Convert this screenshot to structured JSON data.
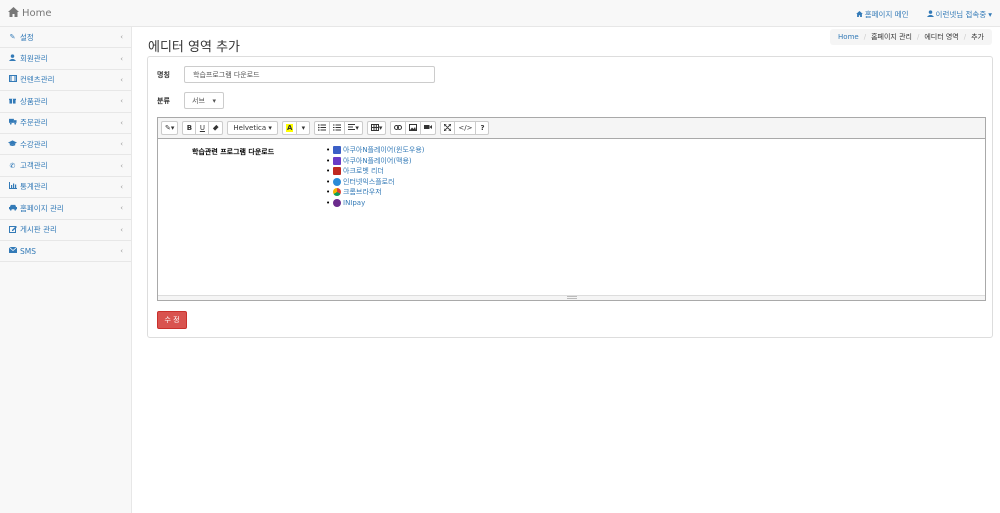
{
  "navbar": {
    "brand": "Home",
    "homepage_main": "홈페이지 메인",
    "user": "이런넷님 접속중"
  },
  "sidebar": {
    "items": [
      {
        "label": "설정",
        "icon": "wrench-icon"
      },
      {
        "label": "회원관리",
        "icon": "user-icon"
      },
      {
        "label": "컨텐츠관리",
        "icon": "film-icon"
      },
      {
        "label": "상품관리",
        "icon": "gift-icon"
      },
      {
        "label": "주문관리",
        "icon": "truck-icon"
      },
      {
        "label": "수강관리",
        "icon": "graduation-cap-icon"
      },
      {
        "label": "고객관리",
        "icon": "phone-icon"
      },
      {
        "label": "통계관리",
        "icon": "bar-chart-icon"
      },
      {
        "label": "홈페이지 관리",
        "icon": "car-icon"
      },
      {
        "label": "게시판 관리",
        "icon": "edit-icon"
      },
      {
        "label": "SMS",
        "icon": "envelope-icon"
      }
    ]
  },
  "page": {
    "title": "에디터 영역 추가"
  },
  "breadcrumb": {
    "home": "Home",
    "level1": "홈페이지 관리",
    "level2": "에디터 영역",
    "current": "추가"
  },
  "form": {
    "name_label": "명칭",
    "name_value": "학습프로그램 다운로드",
    "category_label": "분류",
    "category_value": "서브"
  },
  "toolbar": {
    "font_family": "Helvetica",
    "bold": "B",
    "underline": "U",
    "font_color": "A",
    "help": "?",
    "codeview": "</>"
  },
  "content": {
    "title": "학습관련 프로그램 다운로드",
    "downloads": [
      {
        "label": "아쿠아N플레이어(윈도우용)",
        "color": "#3b5fc6"
      },
      {
        "label": "아쿠아N플레이어(맥용)",
        "color": "#6a3bc6"
      },
      {
        "label": "아크로벳 리더",
        "color": "#c0281f"
      },
      {
        "label": "인터넷익스플로러",
        "color": "#2b8ad6"
      },
      {
        "label": "크롬브라우저",
        "color": "#e3a21a"
      },
      {
        "label": "INIpay",
        "color": "#6b2a8c"
      }
    ]
  },
  "actions": {
    "save": "수 정"
  },
  "colors": {
    "link": "#337ab7",
    "danger": "#d9534f"
  }
}
